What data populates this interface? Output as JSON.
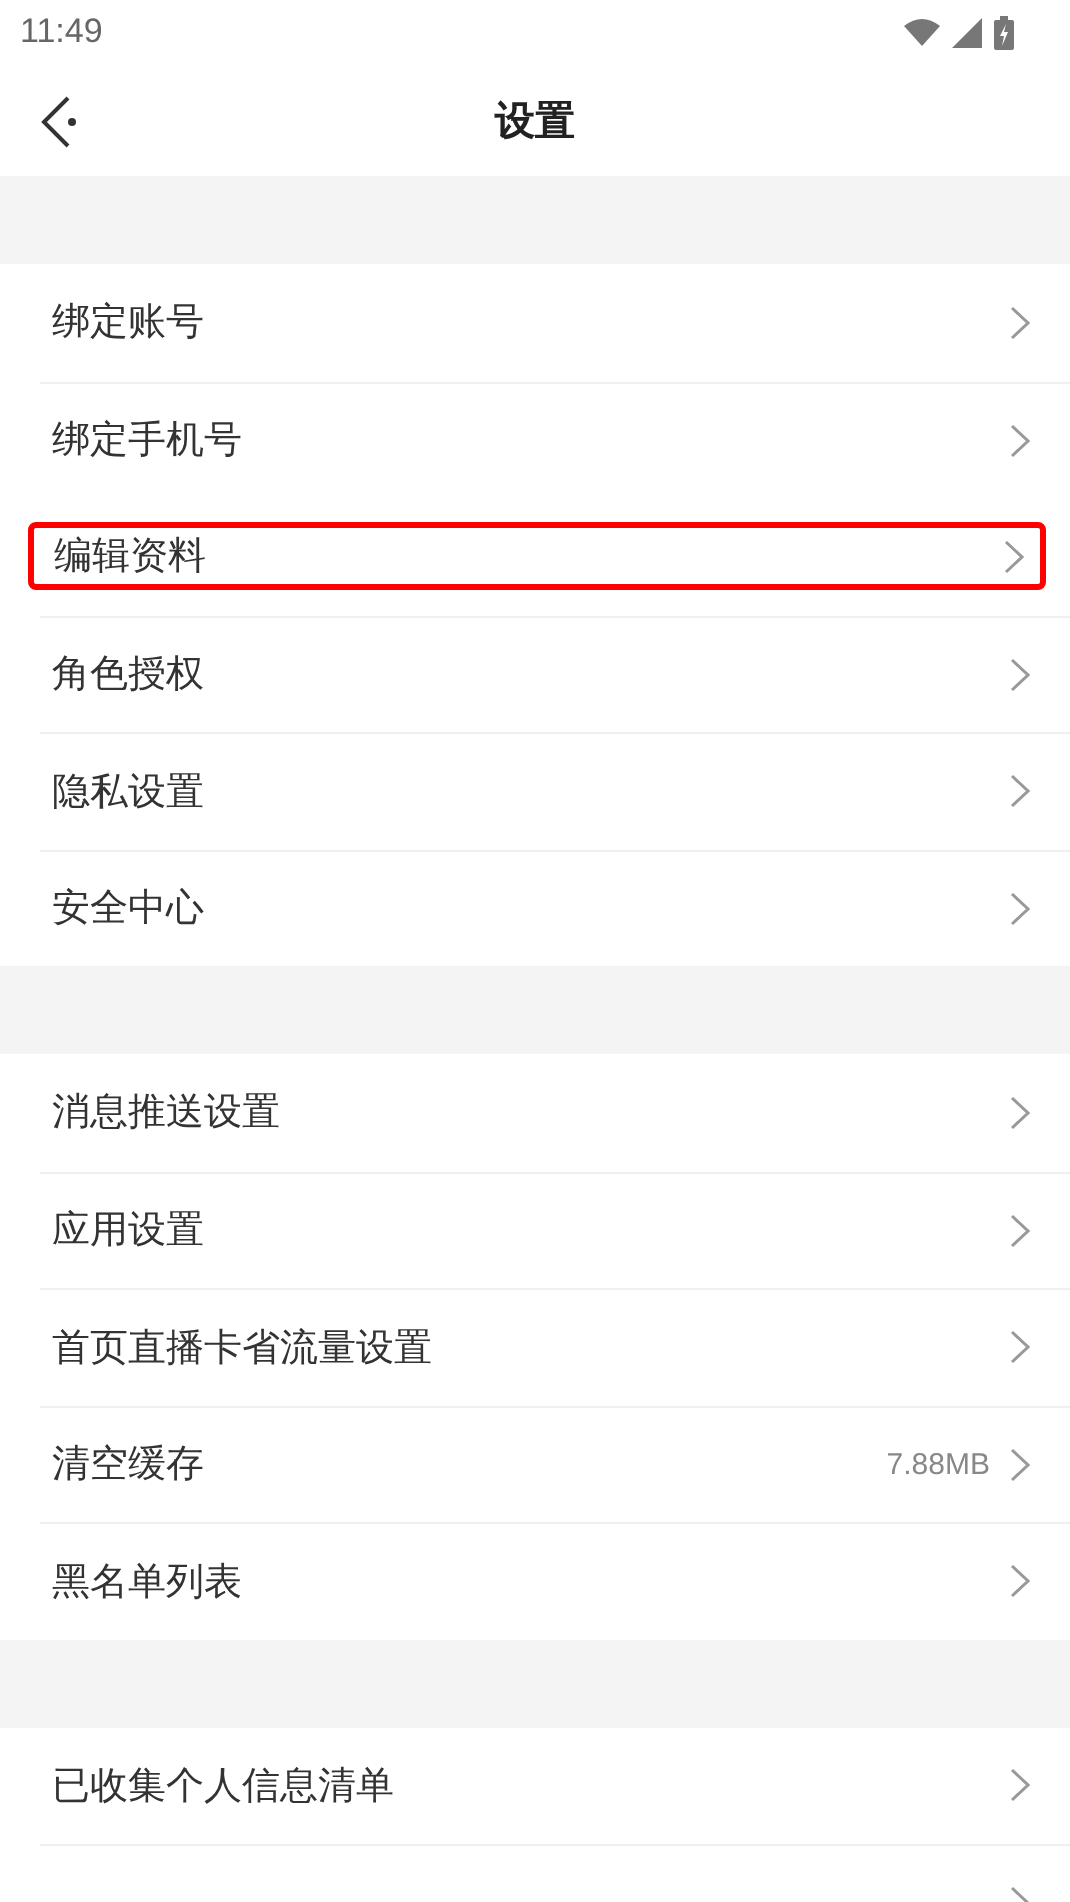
{
  "status_bar": {
    "time": "11:49"
  },
  "header": {
    "title": "设置"
  },
  "sections": [
    {
      "items": [
        {
          "label": "绑定账号",
          "highlighted": false
        },
        {
          "label": "绑定手机号",
          "highlighted": false
        },
        {
          "label": "编辑资料",
          "highlighted": true
        },
        {
          "label": "角色授权",
          "highlighted": false
        },
        {
          "label": "隐私设置",
          "highlighted": false
        },
        {
          "label": "安全中心",
          "highlighted": false
        }
      ]
    },
    {
      "items": [
        {
          "label": "消息推送设置",
          "highlighted": false
        },
        {
          "label": "应用设置",
          "highlighted": false
        },
        {
          "label": "首页直播卡省流量设置",
          "highlighted": false
        },
        {
          "label": "清空缓存",
          "value": "7.88MB",
          "highlighted": false
        },
        {
          "label": "黑名单列表",
          "highlighted": false
        }
      ]
    },
    {
      "items": [
        {
          "label": "已收集个人信息清单",
          "highlighted": false
        },
        {
          "highlighted": false
        }
      ]
    }
  ]
}
